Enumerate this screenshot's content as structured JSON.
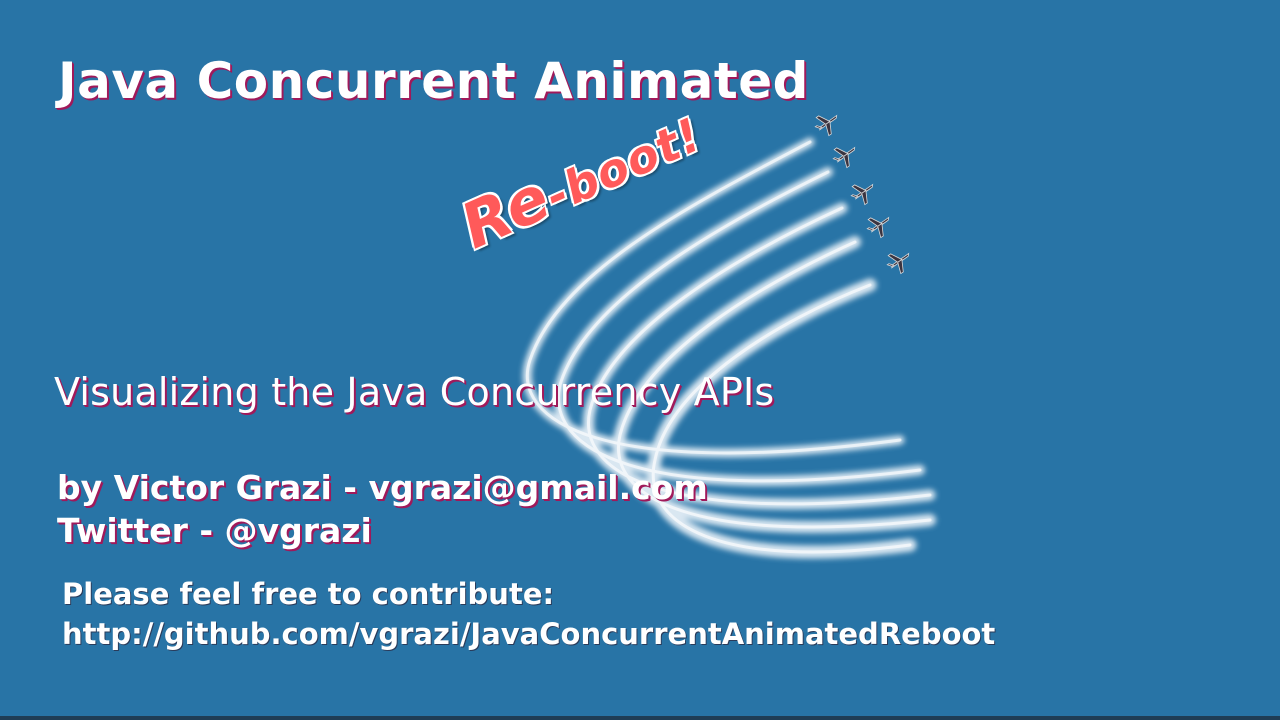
{
  "slide": {
    "title": "Java Concurrent Animated",
    "badge": "Re-boot!",
    "badge_part1": "Re",
    "badge_part2": "-boot!",
    "subtitle": "Visualizing the Java Concurrency APIs",
    "author_line": "by Victor Grazi - vgrazi@gmail.com",
    "twitter_line": "Twitter - @vgrazi",
    "contribute_line": "Please feel free to contribute:",
    "repo_url": "http://github.com/vgrazi/JavaConcurrentAnimatedReboot"
  },
  "colors": {
    "background": "#2874a6",
    "text": "#ffffff",
    "text_shadow": "#a0195a",
    "badge": "#ff5a5a"
  },
  "art": {
    "icon": "jet-formation-icon",
    "jets": 5
  }
}
